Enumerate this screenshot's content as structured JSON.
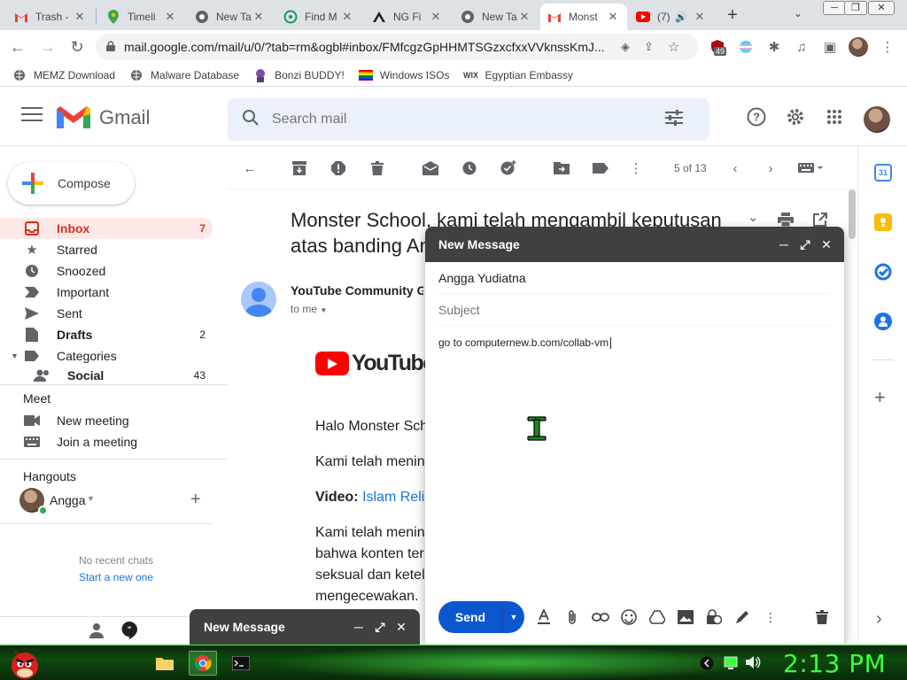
{
  "browser": {
    "tabs": [
      {
        "label": "Trash -",
        "icon": "gmail-icon"
      },
      {
        "label": "Timeli",
        "icon": "maps-pin-icon"
      },
      {
        "label": "New Ta",
        "icon": "chrome-icon"
      },
      {
        "label": "Find M",
        "icon": "green-circle-icon"
      },
      {
        "label": "NG Fi",
        "icon": "ng-logo-icon"
      },
      {
        "label": "New Ta",
        "icon": "chrome-icon"
      },
      {
        "label": "Monst",
        "icon": "gmail-icon"
      },
      {
        "label": "(7)",
        "icon": "youtube-icon"
      }
    ],
    "url": "mail.google.com/mail/u/0/?tab=rm&ogbl#inbox/FMfcgzGpHHMTSGzxcfxxVVknssKmJ...",
    "extension_badge": "49",
    "bookmarks": [
      "MEMZ Download",
      "Malware Database",
      "Bonzi BUDDY!",
      "Windows ISOs",
      "Egyptian Embassy"
    ],
    "bookmark_wix_label": "WIX"
  },
  "gmail": {
    "brand": "Gmail",
    "search_placeholder": "Search mail",
    "compose_label": "Compose",
    "nav": [
      {
        "label": "Inbox",
        "count": "7"
      },
      {
        "label": "Starred",
        "count": ""
      },
      {
        "label": "Snoozed",
        "count": ""
      },
      {
        "label": "Important",
        "count": ""
      },
      {
        "label": "Sent",
        "count": ""
      },
      {
        "label": "Drafts",
        "count": "2"
      },
      {
        "label": "Categories",
        "count": ""
      },
      {
        "label": "Social",
        "count": "43"
      }
    ],
    "meet": {
      "title": "Meet",
      "new_meeting": "New meeting",
      "join_meeting": "Join a meeting"
    },
    "hangouts": {
      "title": "Hangouts",
      "user": "Angga",
      "no_chats": "No recent chats",
      "start_chat": "Start a new one"
    },
    "pager": "5 of 13",
    "calendar_day": "31",
    "message": {
      "subject": "Monster School, kami telah mengambil keputusan atas banding An",
      "sender": "YouTube Community Gu",
      "recipient": "to me",
      "logo_text": "YouTube",
      "lines": [
        "Halo Monster Sch",
        "Kami telah menin",
        "Kami telah menin",
        "bahwa konten ter",
        "seksual dan ketel",
        "mengecewakan."
      ],
      "video_label": "Video:",
      "video_link": "Islam Reli"
    }
  },
  "compose_window": {
    "title": "New Message",
    "to": "Angga Yudiatna",
    "subject_placeholder": "Subject",
    "body": "go to computernew.b.com/collab-vm",
    "send_label": "Send"
  },
  "compose_minimized": {
    "title": "New Message"
  },
  "taskbar": {
    "clock": "2:13 PM"
  }
}
